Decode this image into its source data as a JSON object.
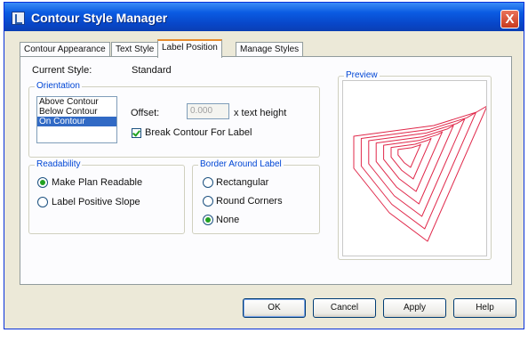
{
  "window": {
    "title": "Contour Style Manager",
    "close_glyph": "X"
  },
  "tabs": [
    {
      "label": "Contour Appearance",
      "active": false
    },
    {
      "label": "Text Style",
      "active": false
    },
    {
      "label": "Label Position",
      "active": true
    },
    {
      "label": "Manage Styles",
      "active": false
    }
  ],
  "current_style": {
    "label": "Current Style:",
    "value": "Standard"
  },
  "orientation": {
    "legend": "Orientation",
    "items": [
      "Above Contour",
      "Below Contour",
      "On Contour"
    ],
    "selected": "On Contour",
    "offset_label": "Offset:",
    "offset_value": "0.000",
    "offset_unit": "x text height",
    "break_label": "Break Contour For Label",
    "break_checked": true
  },
  "readability": {
    "legend": "Readability",
    "options": [
      "Make Plan Readable",
      "Label Positive Slope"
    ],
    "selected": "Make Plan Readable"
  },
  "border": {
    "legend": "Border Around Label",
    "options": [
      "Rectangular",
      "Round Corners",
      "None"
    ],
    "selected": "None"
  },
  "preview": {
    "legend": "Preview",
    "line_color": "#e0284a"
  },
  "buttons": {
    "ok": "OK",
    "cancel": "Cancel",
    "apply": "Apply",
    "help": "Help"
  },
  "colors": {
    "titlebar": "#0a5be2",
    "accent_legend": "#0046d5",
    "selection": "#316ac5"
  }
}
